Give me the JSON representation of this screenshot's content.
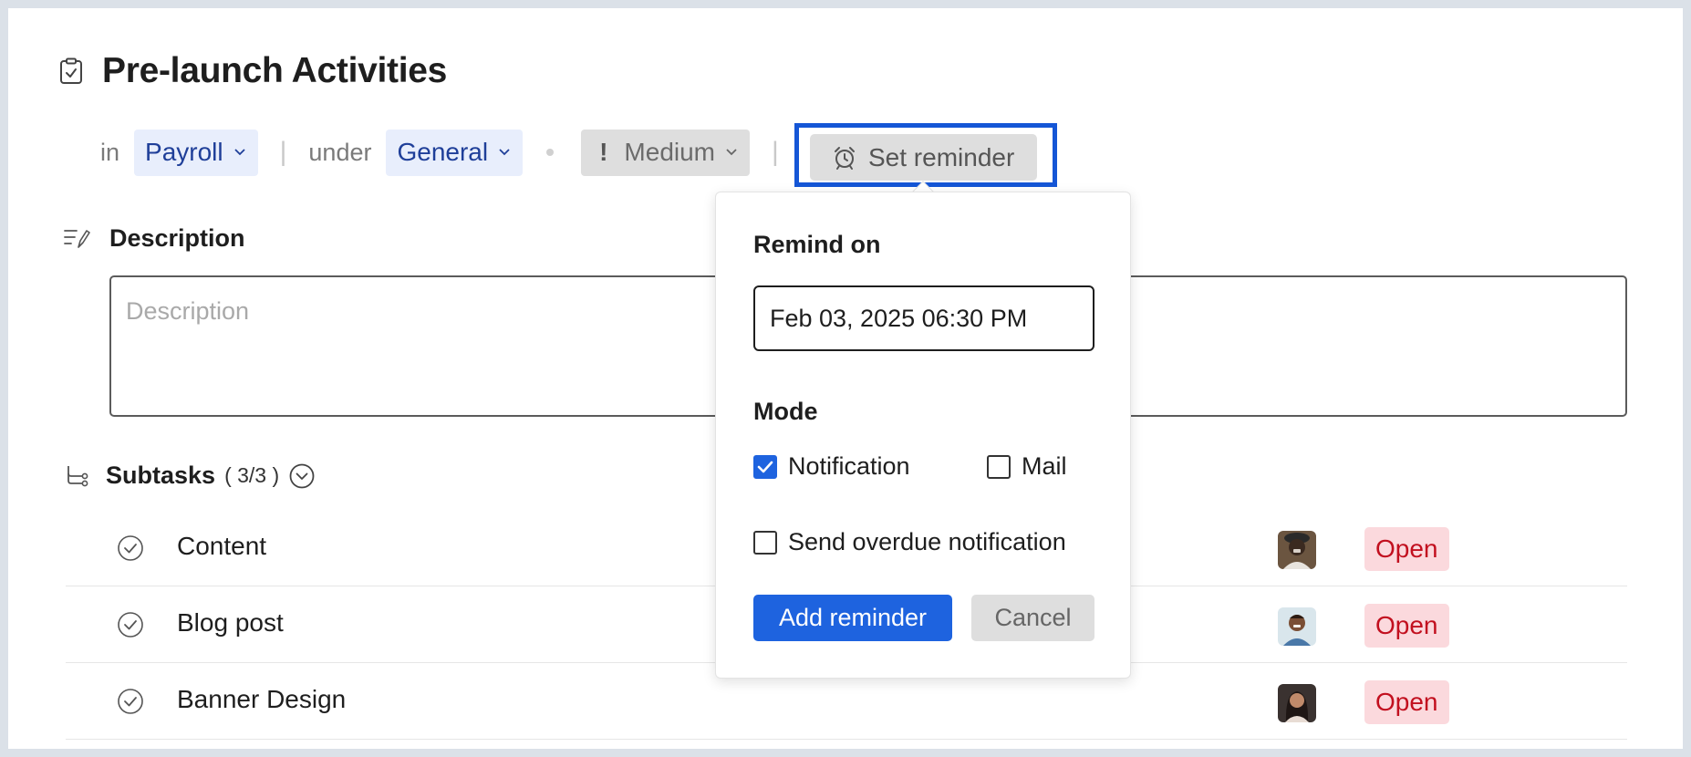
{
  "task": {
    "title": "Pre-launch Activities",
    "title_icon": "clipboard-check-icon"
  },
  "meta": {
    "in_label": "in",
    "project": "Payroll",
    "under_label": "under",
    "tasklist": "General",
    "priority_symbol": "!",
    "priority": "Medium",
    "reminder_button": "Set reminder"
  },
  "description": {
    "label": "Description",
    "placeholder": "Description"
  },
  "subtasks": {
    "label": "Subtasks",
    "count": "( 3/3 )",
    "items": [
      {
        "name": "Content",
        "status": "Open"
      },
      {
        "name": "Blog post",
        "status": "Open"
      },
      {
        "name": "Banner Design",
        "status": "Open"
      }
    ]
  },
  "reminder_popover": {
    "remind_on_label": "Remind on",
    "date_value": "Feb 03, 2025 06:30 PM",
    "mode_label": "Mode",
    "notification_label": "Notification",
    "notification_checked": true,
    "mail_label": "Mail",
    "mail_checked": false,
    "overdue_label": "Send overdue notification",
    "overdue_checked": false,
    "add_button": "Add reminder",
    "cancel_button": "Cancel"
  },
  "colors": {
    "accent": "#1e63df",
    "focus_outline": "#1556d6",
    "status_open_bg": "#fbd9dd",
    "status_open_text": "#c2101f",
    "chip_blue_bg": "#e8eefc"
  }
}
